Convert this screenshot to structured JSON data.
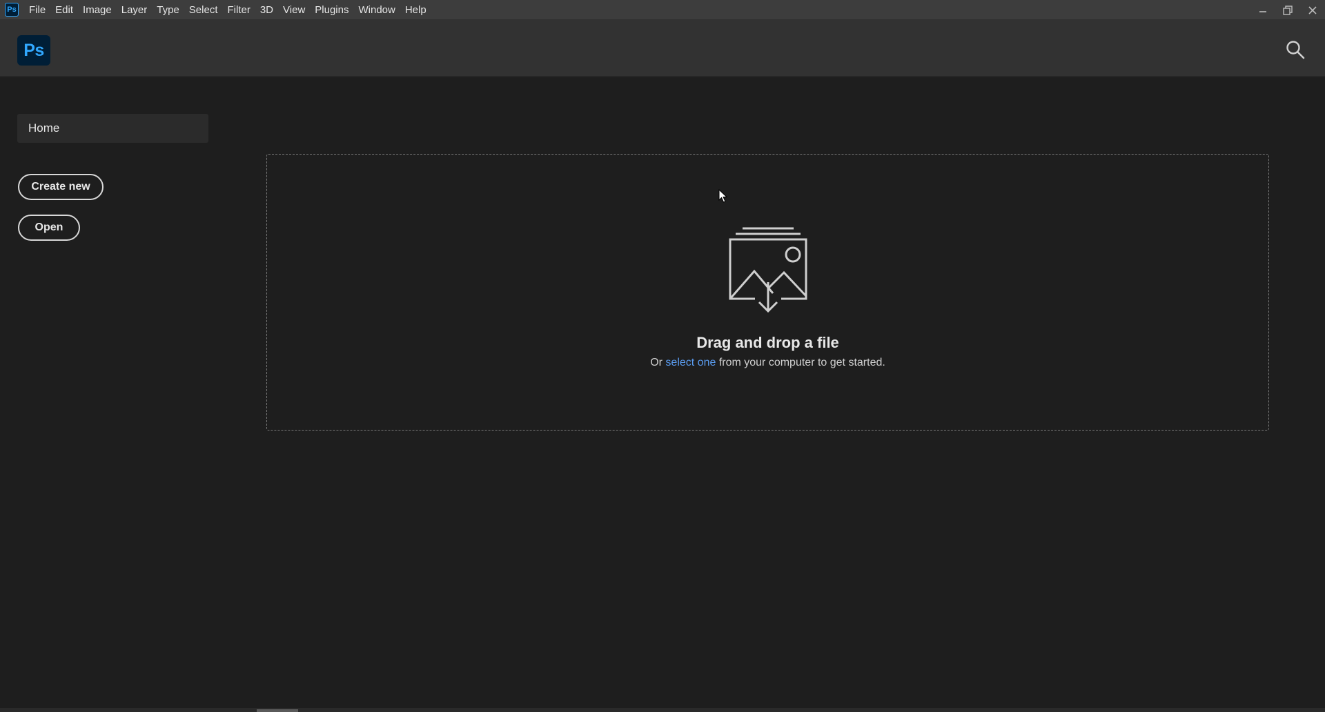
{
  "app": {
    "small_icon_label": "Ps",
    "logo_label": "Ps",
    "brand_color": "#31a8ff",
    "brand_bg": "#001e36"
  },
  "menubar": {
    "items": [
      "File",
      "Edit",
      "Image",
      "Layer",
      "Type",
      "Select",
      "Filter",
      "3D",
      "View",
      "Plugins",
      "Window",
      "Help"
    ]
  },
  "window_controls": {
    "icons": [
      "minimize-icon",
      "restore-icon",
      "close-icon"
    ]
  },
  "header": {
    "search_icon": "search-icon"
  },
  "sidebar": {
    "home_label": "Home",
    "create_new_label": "Create new",
    "open_label": "Open"
  },
  "dropzone": {
    "icon": "image-download-icon",
    "title": "Drag and drop a file",
    "subtitle_prefix": "Or",
    "subtitle_link": "select one",
    "subtitle_suffix": "from your computer to get started.",
    "link_color": "#5a9cf0"
  }
}
